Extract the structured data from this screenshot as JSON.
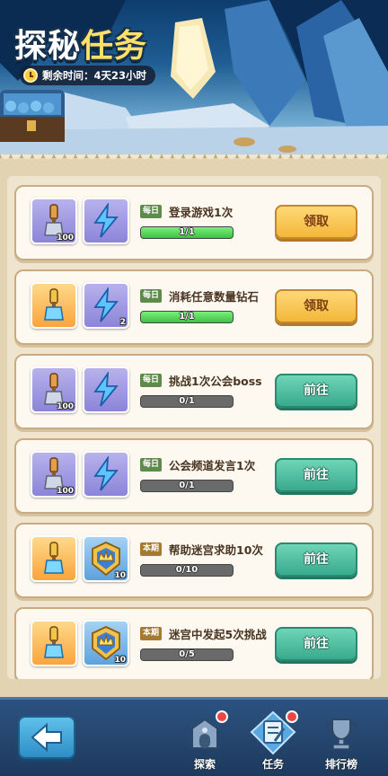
{
  "header": {
    "title_part1": "探秘",
    "title_part2": "任务",
    "remaining_label": "剩余时间：",
    "remaining_value": "4天23小时"
  },
  "tasks": [
    {
      "tag": "每日",
      "tag_type": "daily",
      "title": "登录游戏1次",
      "progress_text": "1/1",
      "progress_fraction": 1.0,
      "button_label": "领取",
      "button_type": "claim",
      "rewards": [
        {
          "icon": "shovel-icon",
          "bg": "purple",
          "qty": "100"
        },
        {
          "icon": "lightning-gem-icon",
          "bg": "purple",
          "qty": ""
        }
      ]
    },
    {
      "tag": "每日",
      "tag_type": "daily",
      "title": "消耗任意数量钻石",
      "progress_text": "1/1",
      "progress_fraction": 1.0,
      "button_label": "领取",
      "button_type": "claim",
      "rewards": [
        {
          "icon": "blue-shovel-icon",
          "bg": "orange",
          "qty": ""
        },
        {
          "icon": "lightning-gem-icon",
          "bg": "purple",
          "qty": "2"
        }
      ]
    },
    {
      "tag": "每日",
      "tag_type": "daily",
      "title": "挑战1次公会boss",
      "progress_text": "0/1",
      "progress_fraction": 0.0,
      "button_label": "前往",
      "button_type": "go",
      "rewards": [
        {
          "icon": "shovel-icon",
          "bg": "purple",
          "qty": "100"
        },
        {
          "icon": "lightning-gem-icon",
          "bg": "purple",
          "qty": ""
        }
      ]
    },
    {
      "tag": "每日",
      "tag_type": "daily",
      "title": "公会频道发言1次",
      "progress_text": "0/1",
      "progress_fraction": 0.0,
      "button_label": "前往",
      "button_type": "go",
      "rewards": [
        {
          "icon": "shovel-icon",
          "bg": "purple",
          "qty": "100"
        },
        {
          "icon": "lightning-gem-icon",
          "bg": "purple",
          "qty": ""
        }
      ]
    },
    {
      "tag": "本期",
      "tag_type": "period",
      "title": "帮助迷宫求助10次",
      "progress_text": "0/10",
      "progress_fraction": 0.0,
      "button_label": "前往",
      "button_type": "go",
      "rewards": [
        {
          "icon": "blue-shovel-icon",
          "bg": "orange",
          "qty": ""
        },
        {
          "icon": "crown-badge-icon",
          "bg": "blue",
          "qty": "10"
        }
      ]
    },
    {
      "tag": "本期",
      "tag_type": "period",
      "title": "迷宫中发起5次挑战",
      "progress_text": "0/5",
      "progress_fraction": 0.0,
      "button_label": "前往",
      "button_type": "go",
      "rewards": [
        {
          "icon": "blue-shovel-icon",
          "bg": "orange",
          "qty": ""
        },
        {
          "icon": "crown-badge-icon",
          "bg": "blue",
          "qty": "10"
        }
      ]
    }
  ],
  "nav": {
    "explore_label": "探索",
    "tasks_label": "任务",
    "rank_label": "排行榜"
  },
  "colors": {
    "claim_button": "#f3b73a",
    "go_button": "#39aa8d",
    "progress_fill": "#3dc241",
    "daily_tag": "#5e8b4c",
    "period_tag": "#a87a2f"
  }
}
